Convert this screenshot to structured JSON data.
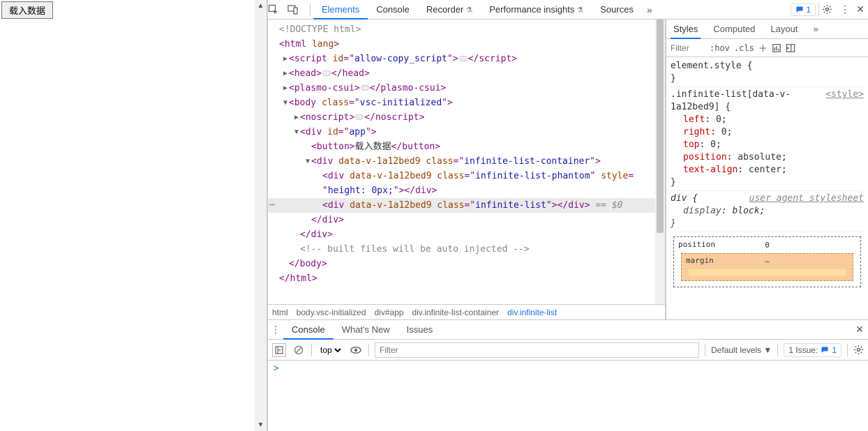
{
  "page": {
    "load_button": "载入数据"
  },
  "toolbar": {
    "tabs": [
      "Elements",
      "Console",
      "Recorder",
      "Performance insights",
      "Sources"
    ],
    "active_tab": "Elements",
    "issue_count": "1"
  },
  "dom": {
    "l0": "<!DOCTYPE html>",
    "l1_open": "<",
    "l1_tag": "html",
    "l1_attr": " lang",
    "l1_close": ">",
    "l2_a": "<",
    "l2_tag": "script",
    "l2_attr": " id",
    "l2_eq": "=\"",
    "l2_val": "allow-copy_script",
    "l2_q": "\"",
    "l2_b": ">",
    "l2_c": "</",
    "l2_d": ">",
    "l3_a": "<",
    "l3_tag": "head",
    "l3_b": ">",
    "l3_c": "</",
    "l3_d": ">",
    "l4_a": "<",
    "l4_tag": "plasmo-csui",
    "l4_b": ">",
    "l4_c": "</",
    "l4_d": ">",
    "l5_a": "<",
    "l5_tag": "body",
    "l5_attr": " class",
    "l5_eq": "=\"",
    "l5_val": "vsc-initialized",
    "l5_q": "\"",
    "l5_b": ">",
    "l6_a": "<",
    "l6_tag": "noscript",
    "l6_b": ">",
    "l6_c": "</",
    "l6_d": ">",
    "l7_a": "<",
    "l7_tag": "div",
    "l7_attr": " id",
    "l7_eq": "=\"",
    "l7_val": "app",
    "l7_q": "\"",
    "l7_b": ">",
    "l8_a": "<",
    "l8_tag": "button",
    "l8_b": ">",
    "l8_text": "载入数据",
    "l8_c": "</",
    "l8_d": ">",
    "l9_a": "<",
    "l9_tag": "div",
    "l9_attr": " data-v-1a12bed9",
    "l9_attr2": " class",
    "l9_eq": "=\"",
    "l9_val": "infinite-list-container",
    "l9_q": "\"",
    "l9_b": ">",
    "l10_a": "<",
    "l10_tag": "div",
    "l10_attr": " data-v-1a12bed9",
    "l10_attr2": " class",
    "l10_eq": "=\"",
    "l10_val": "infinite-list-phantom",
    "l10_q": "\"",
    "l10_attr3": " style",
    "l10_eq2": "=",
    "l10b_q1": "\"",
    "l10b_val": "height: 0px;",
    "l10b_q2": "\"",
    "l10b_b": ">",
    "l10b_c": "</",
    "l10b_tag": "div",
    "l10b_d": ">",
    "l11_a": "<",
    "l11_tag": "div",
    "l11_attr": " data-v-1a12bed9",
    "l11_attr2": " class",
    "l11_eq": "=\"",
    "l11_val": "infinite-list",
    "l11_q": "\"",
    "l11_b": ">",
    "l11_c": "</",
    "l11_d": ">",
    "l11_dim": " == $0",
    "l12": "</",
    "l12_tag": "div",
    "l12_b": ">",
    "l13": "</",
    "l13_tag": "div",
    "l13_b": ">",
    "l14": "<!-- built files will be auto injected -->",
    "l15": "</",
    "l15_tag": "body",
    "l15_b": ">",
    "l16": "</",
    "l16_tag": "html",
    "l16_b": ">"
  },
  "breadcrumb": {
    "items": [
      "html",
      "body.vsc-initialized",
      "div#app",
      "div.infinite-list-container",
      "div.infinite-list"
    ]
  },
  "styles": {
    "tabs": {
      "styles": "Styles",
      "computed": "Computed",
      "layout": "Layout"
    },
    "filter_placeholder": "Filter",
    "hov": ":hov",
    "cls": ".cls",
    "element_style": "element.style {",
    "close_brace": "}",
    "rule1": {
      "selector": ".infinite-list[data-v-1a12bed9] {",
      "source": "<style>",
      "props": {
        "p1k": "left",
        "p1v": ": 0;",
        "p2k": "right",
        "p2v": ": 0;",
        "p3k": "top",
        "p3v": ": 0;",
        "p4k": "position",
        "p4v": ": absolute;",
        "p5k": "text-align",
        "p5v": ": center;"
      }
    },
    "rule2": {
      "selector": "div {",
      "source": "user agent stylesheet",
      "p1k": "display",
      "p1v": ": block;"
    },
    "box": {
      "position_label": "position",
      "position_top": "0",
      "margin_label": "margin",
      "margin_top": "–"
    }
  },
  "drawer": {
    "tabs": {
      "console": "Console",
      "whatsnew": "What's New",
      "issues": "Issues"
    },
    "context": "top",
    "filter_placeholder": "Filter",
    "levels": "Default levels",
    "issue_label": "1 Issue:",
    "issue_count": "1",
    "prompt": ">"
  }
}
